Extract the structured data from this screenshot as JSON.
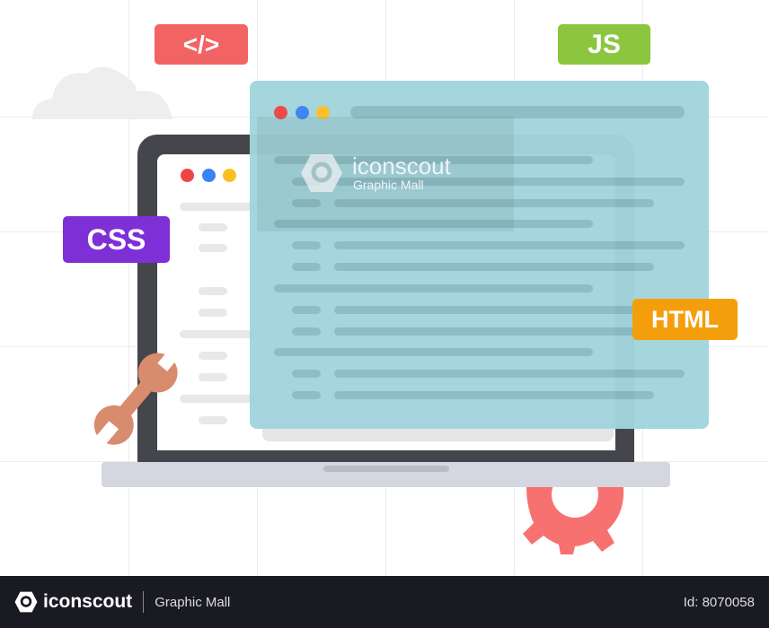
{
  "badges": {
    "html_tag": "</>",
    "js": "JS",
    "css": "CSS",
    "html": "HTML"
  },
  "colors": {
    "red": "#f26464",
    "green": "#8cc63f",
    "purple": "#7e2fd6",
    "orange": "#f59e0b",
    "window": "#a3d5dc",
    "laptop": "#45464c",
    "gear": "#f87171",
    "wrench": "#d98b6e"
  },
  "watermark": {
    "brand": "iconscout",
    "sub": "Graphic Mall"
  },
  "footer": {
    "brand": "iconscout",
    "author": "Graphic Mall",
    "id": "Id: 8070058"
  }
}
